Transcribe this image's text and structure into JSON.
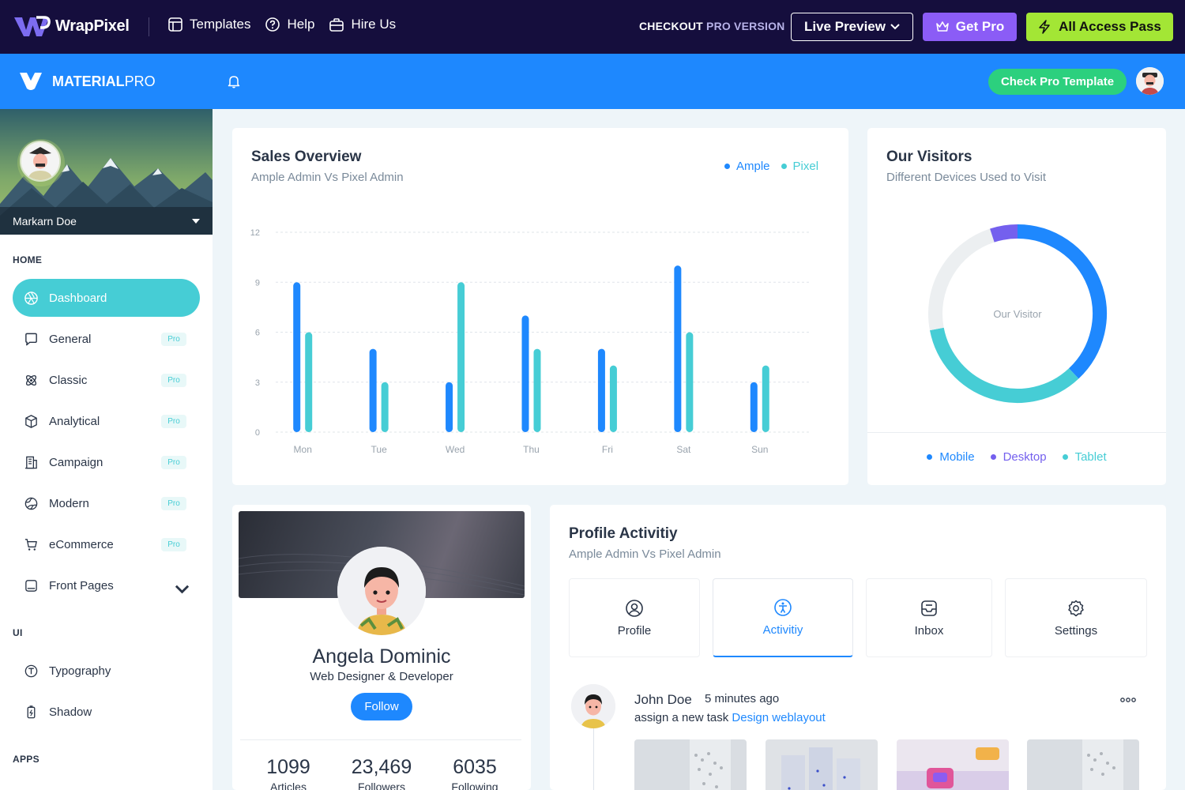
{
  "promo": {
    "brand": "WrapPixel",
    "nav": [
      {
        "label": "Templates",
        "icon": "layout-icon"
      },
      {
        "label": "Help",
        "icon": "help-circle-icon"
      },
      {
        "label": "Hire Us",
        "icon": "briefcase-icon"
      }
    ],
    "checkout_prefix": "CHECKOUT",
    "checkout_pro": "PRO VERSION",
    "live_preview": "Live Preview",
    "get_pro": "Get Pro",
    "all_access": "All Access Pass"
  },
  "header": {
    "brand_bold": "MATERIAL",
    "brand_light": "PRO",
    "check_pro": "Check Pro Template"
  },
  "sidebar": {
    "user_name": "Markarn Doe",
    "section_home": "HOME",
    "section_ui": "UI",
    "section_apps": "APPS",
    "pro_label": "Pro",
    "home_items": [
      {
        "label": "Dashboard",
        "icon": "aperture-icon",
        "active": true
      },
      {
        "label": "General",
        "icon": "message-square-icon",
        "pro": true
      },
      {
        "label": "Classic",
        "icon": "atom-icon",
        "pro": true
      },
      {
        "label": "Analytical",
        "icon": "box-icon",
        "pro": true
      },
      {
        "label": "Campaign",
        "icon": "building-icon",
        "pro": true
      },
      {
        "label": "Modern",
        "icon": "globe-icon",
        "pro": true
      },
      {
        "label": "eCommerce",
        "icon": "cart-icon",
        "pro": true
      },
      {
        "label": "Front Pages",
        "icon": "app-window-icon",
        "expandable": true
      }
    ],
    "ui_items": [
      {
        "label": "Typography",
        "icon": "typography-icon"
      },
      {
        "label": "Shadow",
        "icon": "battery-charging-icon"
      }
    ]
  },
  "sales": {
    "title": "Sales Overview",
    "subtitle": "Ample Admin Vs Pixel Admin",
    "colors": {
      "ample": "#1e88fe",
      "pixel": "#46cdd5"
    }
  },
  "visitors": {
    "title": "Our Visitors",
    "subtitle": "Different Devices Used to Visit",
    "center_label": "Our Visitor",
    "legend": [
      {
        "label": "Mobile",
        "color": "#1e88fe"
      },
      {
        "label": "Desktop",
        "color": "#7460ee"
      },
      {
        "label": "Tablet",
        "color": "#46cdd5"
      }
    ]
  },
  "profile_card": {
    "name": "Angela Dominic",
    "role": "Web Designer & Developer",
    "follow": "Follow",
    "stats": [
      {
        "value": "1099",
        "label": "Articles"
      },
      {
        "value": "23,469",
        "label": "Followers"
      },
      {
        "value": "6035",
        "label": "Following"
      }
    ]
  },
  "activity": {
    "title": "Profile Activitiy",
    "subtitle": "Ample Admin Vs Pixel Admin",
    "tabs": [
      {
        "label": "Profile",
        "icon": "user-circle-icon"
      },
      {
        "label": "Activitiy",
        "icon": "accessibility-icon",
        "active": true
      },
      {
        "label": "Inbox",
        "icon": "inbox-icon"
      },
      {
        "label": "Settings",
        "icon": "settings-icon"
      }
    ],
    "entry": {
      "name": "John Doe",
      "time": "5 minutes ago",
      "text": "assign a new task",
      "link": "Design weblayout"
    }
  },
  "chart_data": [
    {
      "type": "bar",
      "title": "Sales Overview",
      "subtitle": "Ample Admin Vs Pixel Admin",
      "categories": [
        "Mon",
        "Tue",
        "Wed",
        "Thu",
        "Fri",
        "Sat",
        "Sun"
      ],
      "series": [
        {
          "name": "Ample",
          "color": "#1e88fe",
          "values": [
            9,
            5,
            3,
            7,
            5,
            10,
            3
          ]
        },
        {
          "name": "Pixel",
          "color": "#46cdd5",
          "values": [
            6,
            3,
            9,
            5,
            4,
            6,
            4
          ]
        }
      ],
      "yticks": [
        "0",
        "3",
        "6",
        "9",
        "12"
      ],
      "ylim": [
        0,
        12
      ],
      "grid": true,
      "legend": "top-right"
    },
    {
      "type": "pie",
      "variant": "donut",
      "title": "Our Visitors",
      "subtitle": "Different Devices Used to Visit",
      "center_label": "Our Visitor",
      "slices": [
        {
          "name": "Mobile",
          "color": "#1e88fe",
          "value": 38
        },
        {
          "name": "Tablet",
          "color": "#46cdd5",
          "value": 34
        },
        {
          "name": "Other",
          "color": "#eceff1",
          "value": 23
        },
        {
          "name": "Desktop",
          "color": "#7460ee",
          "value": 5
        }
      ],
      "legend": "bottom"
    }
  ]
}
